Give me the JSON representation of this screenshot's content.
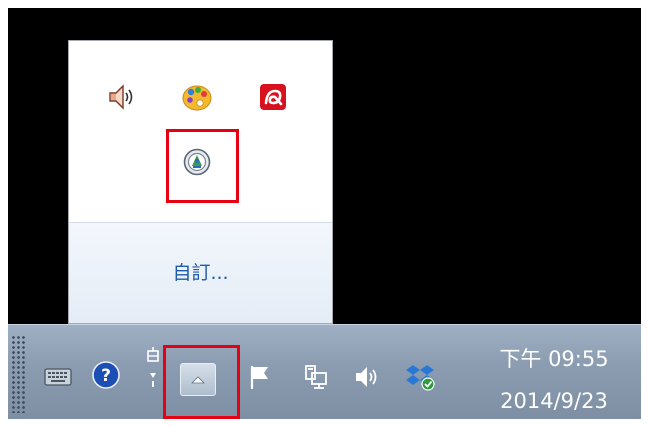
{
  "popup": {
    "customize_label": "自訂...",
    "icons": [
      {
        "name": "volume-mute-icon",
        "row": 1,
        "col": 1
      },
      {
        "name": "paint-palette-icon",
        "row": 1,
        "col": 2
      },
      {
        "name": "avira-antivirus-icon",
        "row": 1,
        "col": 3
      },
      {
        "name": "natural-person-certificate-icon",
        "row": 2,
        "col": 2,
        "highlighted": true
      }
    ]
  },
  "taskbar": {
    "clock_time": "下午 09:55",
    "clock_date": "2014/9/23",
    "icons": [
      "keyboard-icon",
      "help-icon",
      "language-switch-icon",
      "show-hidden-icons-button",
      "action-center-flag-icon",
      "network-icon",
      "volume-icon",
      "dropbox-icon"
    ]
  },
  "colors": {
    "highlight": "#e60012",
    "customize_link": "#1e5aa6",
    "taskbar": "#8c9db2",
    "desktop": "#000000"
  }
}
